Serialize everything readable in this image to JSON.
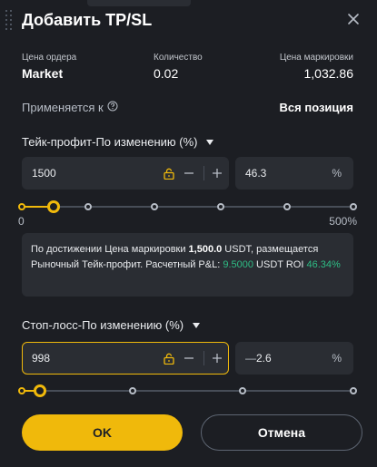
{
  "dialog": {
    "title": "Добавить TP/SL"
  },
  "order_info": {
    "price_label": "Цена ордера",
    "price_value": "Market",
    "qty_label": "Количество",
    "qty_value": "0.02",
    "mark_label": "Цена маркировки",
    "mark_value": "1,032.86"
  },
  "applies": {
    "label": "Применяется к",
    "value": "Вся позиция"
  },
  "take_profit": {
    "title": "Тейк-профит-По изменению (%)",
    "price_value": "1500",
    "percent_value": "46.3",
    "percent_unit": "%",
    "slider_level_percent": 46.3,
    "slider_min_label": "0",
    "slider_max_label": "500%"
  },
  "info": {
    "part1": "По достижении Цена маркировки ",
    "price": "1,500.0",
    "part2": " USDT, размещается Рыночный Тейк-профит. Расчетный P&L: ",
    "pnl": "9.5000",
    "part3": " USDT ROI ",
    "roi": "46.34%"
  },
  "stop_loss": {
    "title": "Стоп-лосс-По изменению (%)",
    "price_value": "998",
    "percent_sign": "—",
    "percent_value": "2.6",
    "percent_unit": "%",
    "slider_level_percent": 2.6
  },
  "buttons": {
    "ok": "OK",
    "cancel": "Отмена"
  },
  "colors": {
    "accent": "#f0b90b",
    "profit": "#2ebd85",
    "background": "#1c1e23",
    "field": "#2a2d33"
  }
}
